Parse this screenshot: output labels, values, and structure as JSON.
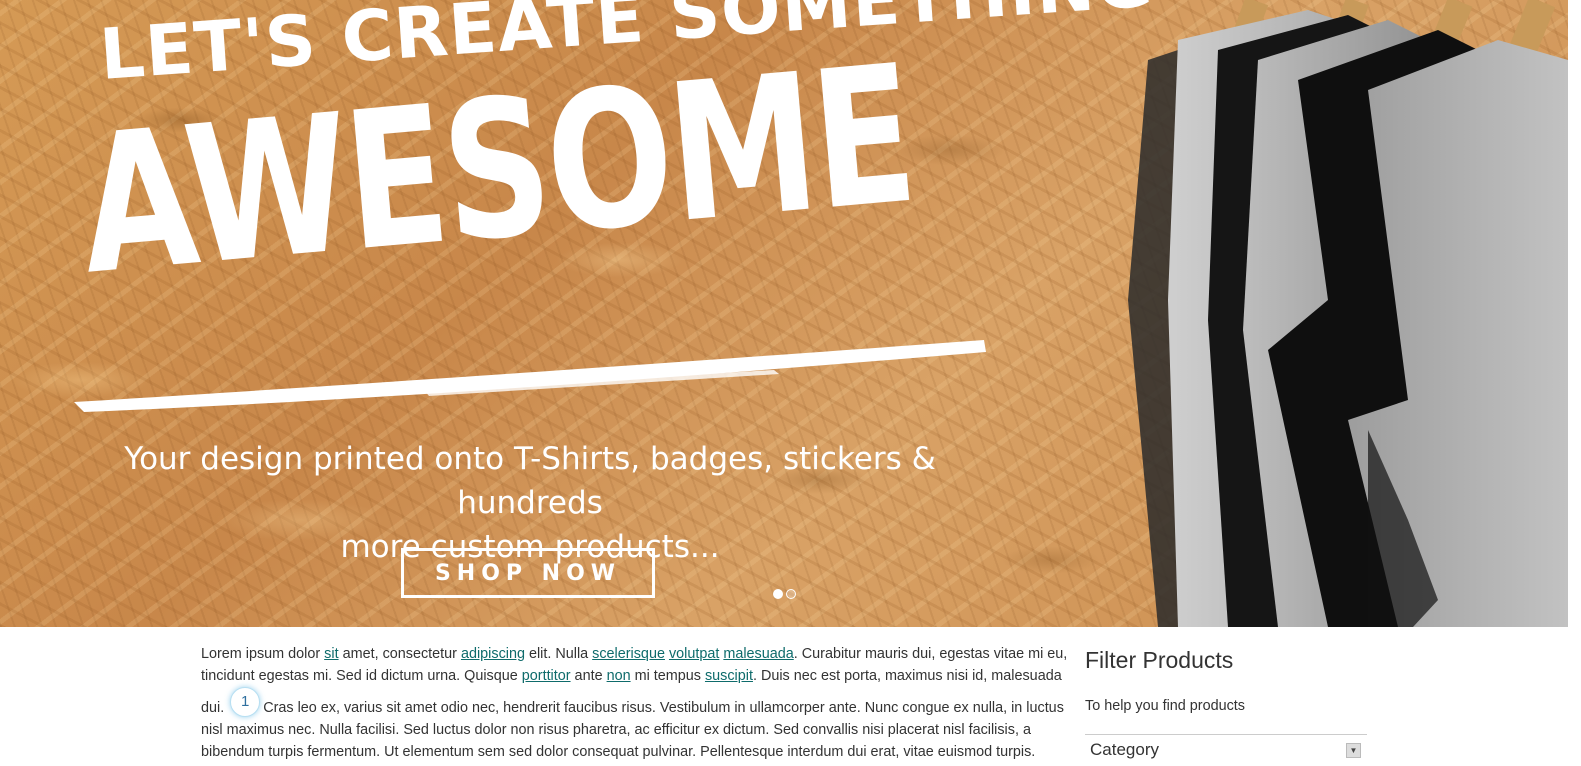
{
  "hero": {
    "eyebrow": "LET'S CREATE SOMETHING",
    "title": "AWESOME",
    "subtitle_line1": "Your design printed onto T-Shirts, badges, stickers & hundreds",
    "subtitle_line2": "more custom products...",
    "cta_label": "SHOP NOW",
    "slides": {
      "count": 2,
      "active": 1
    }
  },
  "content": {
    "intro": {
      "t1": "Lorem ipsum dolor ",
      "l1": "sit",
      "t2": " amet, consectetur ",
      "l2": "adipiscing",
      "t3": " elit. Nulla ",
      "l3": "scelerisque",
      "t4": " ",
      "l4": "volutpat",
      "t5": " ",
      "l5": "malesuada",
      "t6": ". Curabitur mauris dui, egestas vitae mi eu, tincidunt egestas mi. Sed id dictum urna. Quisque ",
      "l6": "porttitor",
      "t7": " ante ",
      "l7": "non",
      "t8": " mi tempus ",
      "l8": "suscipit",
      "t9": ". Duis nec est porta, maximus nisi id, malesuada"
    },
    "second": {
      "lead": "dui.",
      "badge": "1",
      "rest": "Cras leo ex, varius sit amet odio nec, hendrerit faucibus risus. Vestibulum in ullamcorper ante. Nunc congue ex nulla, in luctus nisl maximus nec. Nulla facilisi. Sed luctus dolor non risus pharetra, ac efficitur ex dictum. Sed convallis nisi placerat nisl facilisis, a bibendum turpis fermentum. Ut elementum sem sed dolor consequat pulvinar. Pellentesque interdum dui erat, vitae euismod turpis."
    }
  },
  "filter": {
    "title": "Filter Products",
    "help": "To help you find products",
    "category_label": "Category"
  },
  "colors": {
    "link": "#0e6b6b",
    "hero_wood": "#d59a55",
    "shirt_black": "#111111",
    "shirt_grey": "#9a9a9a"
  }
}
